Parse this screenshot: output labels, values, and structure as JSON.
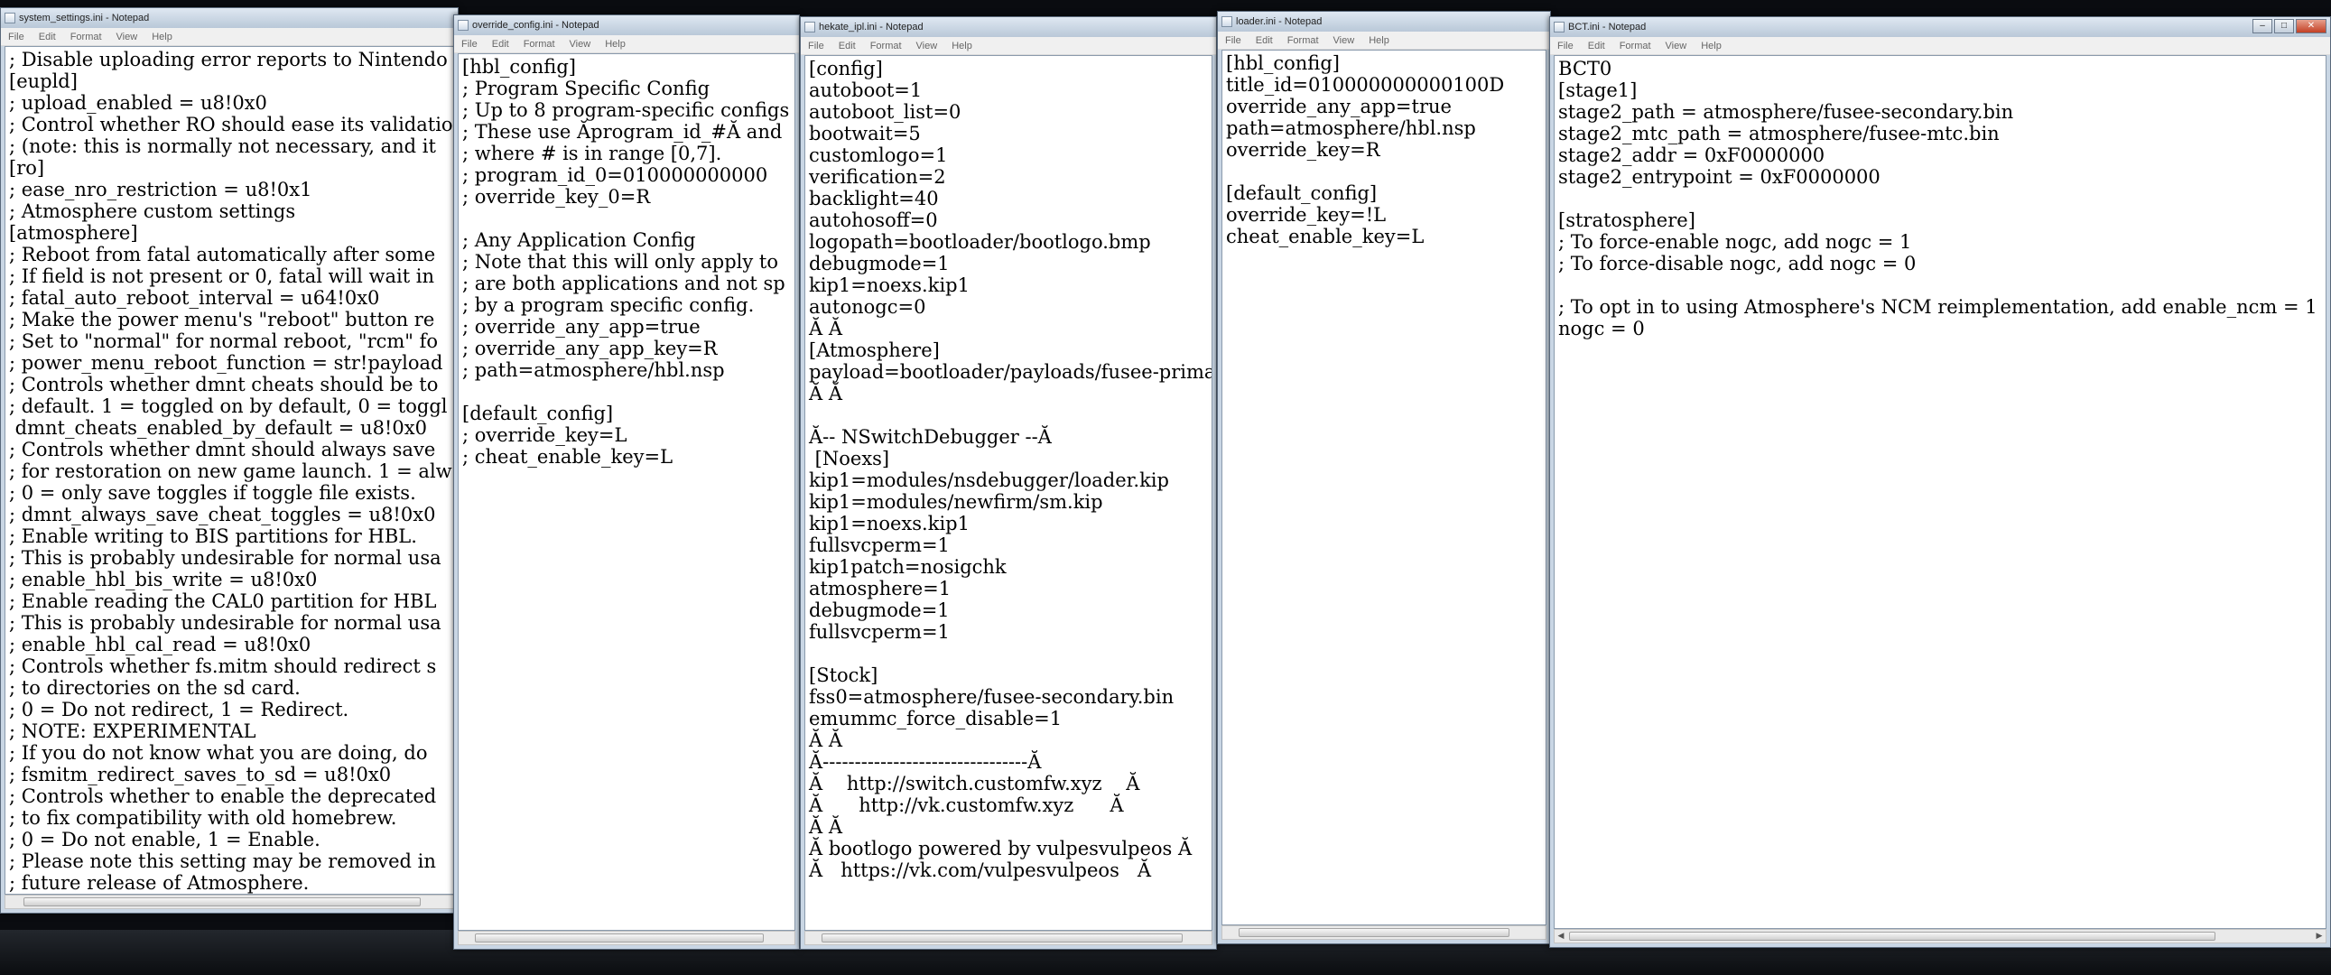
{
  "menu": [
    "File",
    "Edit",
    "Format",
    "View",
    "Help"
  ],
  "windows": [
    {
      "title": "system_settings.ini - Notepad",
      "content": "; Disable uploading error reports to Nintendo\n[eupld]\n; upload_enabled = u8!0x0\n; Control whether RO should ease its validation\n; (note: this is normally not necessary, and it\n[ro]\n; ease_nro_restriction = u8!0x1\n; Atmosphere custom settings\n[atmosphere]\n; Reboot from fatal automatically after some\n; If field is not present or 0, fatal will wait in\n; fatal_auto_reboot_interval = u64!0x0\n; Make the power menu's \"reboot\" button re\n; Set to \"normal\" for normal reboot, \"rcm\" fo\n; power_menu_reboot_function = str!payload\n; Controls whether dmnt cheats should be to\n; default. 1 = toggled on by default, 0 = toggl\n dmnt_cheats_enabled_by_default = u8!0x0\n; Controls whether dmnt should always save\n; for restoration on new game launch. 1 = alw\n; 0 = only save toggles if toggle file exists.\n; dmnt_always_save_cheat_toggles = u8!0x0\n; Enable writing to BIS partitions for HBL.\n; This is probably undesirable for normal usa\n; enable_hbl_bis_write = u8!0x0\n; Enable reading the CAL0 partition for HBL\n; This is probably undesirable for normal usa\n; enable_hbl_cal_read = u8!0x0\n; Controls whether fs.mitm should redirect s\n; to directories on the sd card.\n; 0 = Do not redirect, 1 = Redirect.\n; NOTE: EXPERIMENTAL\n; If you do not know what you are doing, do\n; fsmitm_redirect_saves_to_sd = u8!0x0\n; Controls whether to enable the deprecated\n; to fix compatibility with old homebrew.\n; 0 = Do not enable, 1 = Enable.\n; Please note this setting may be removed in\n; future release of Atmosphere."
    },
    {
      "title": "override_config.ini - Notepad",
      "content": "[hbl_config]\n; Program Specific Config\n; Up to 8 program-specific configs\n; These use Ăprogram_id_#Ă and\n; where # is in range [0,7].\n; program_id_0=010000000000\n; override_key_0=R\n\n; Any Application Config\n; Note that this will only apply to\n; are both applications and not sp\n; by a program specific config.\n; override_any_app=true\n; override_any_app_key=R\n; path=atmosphere/hbl.nsp\n\n[default_config]\n; override_key=L\n; cheat_enable_key=L"
    },
    {
      "title": "hekate_ipl.ini - Notepad",
      "content": "[config]\nautoboot=1\nautoboot_list=0\nbootwait=5\ncustomlogo=1\nverification=2\nbacklight=40\nautohosoff=0\nlogopath=bootloader/bootlogo.bmp\ndebugmode=1\nkip1=noexs.kip1\nautonogc=0\nĂ Ă\n[Atmosphere]\npayload=bootloader/payloads/fusee-primary\nĂ Ă\n\nĂ-- NSwitchDebugger --Ă\n [Noexs]\nkip1=modules/nsdebugger/loader.kip\nkip1=modules/newfirm/sm.kip\nkip1=noexs.kip1\nfullsvcperm=1\nkip1patch=nosigchk\natmosphere=1\ndebugmode=1\nfullsvcperm=1\n\n[Stock]\nfss0=atmosphere/fusee-secondary.bin\nemummc_force_disable=1\nĂ Ă\nĂ--------------------------------Ă\nĂ    http://switch.customfw.xyz    Ă\nĂ      http://vk.customfw.xyz      Ă\nĂ Ă\nĂ bootlogo powered by vulpesvulpeos Ă\nĂ   https://vk.com/vulpesvulpeos   Ă"
    },
    {
      "title": "loader.ini - Notepad",
      "content": "[hbl_config]\ntitle_id=010000000000100D\noverride_any_app=true\npath=atmosphere/hbl.nsp\noverride_key=R\n\n[default_config]\noverride_key=!L\ncheat_enable_key=L"
    },
    {
      "title": "BCT.ini - Notepad",
      "content": "BCT0\n[stage1]\nstage2_path = atmosphere/fusee-secondary.bin\nstage2_mtc_path = atmosphere/fusee-mtc.bin\nstage2_addr = 0xF0000000\nstage2_entrypoint = 0xF0000000\n\n[stratosphere]\n; To force-enable nogc, add nogc = 1\n; To force-disable nogc, add nogc = 0\n\n; To opt in to using Atmosphere's NCM reimplementation, add enable_ncm = 1\nnogc = 0"
    }
  ]
}
